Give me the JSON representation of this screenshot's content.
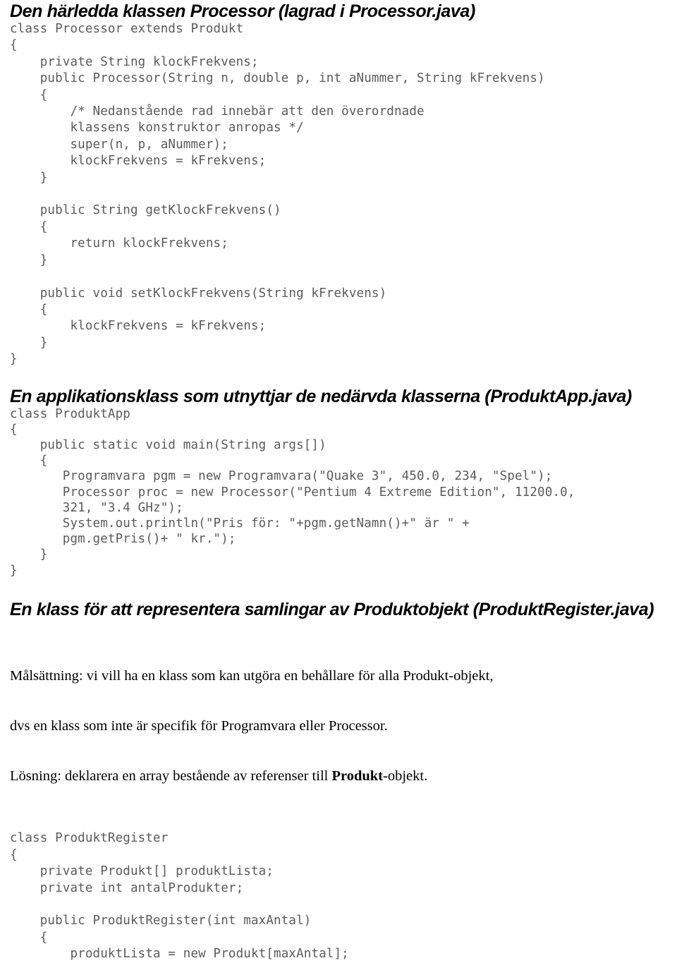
{
  "document": {
    "language": "sv",
    "sections": [
      {
        "id": "processor-class",
        "heading": "Den härledda klassen Processor (lagrad i Processor.java)",
        "code": [
          "class Processor extends Produkt",
          "{",
          "    private String klockFrekvens;",
          "    public Processor(String n, double p, int aNummer, String kFrekvens)",
          "    {",
          "        /* Nedanstående rad innebär att den överordnade",
          "        klassens konstruktor anropas */",
          "        super(n, p, aNummer);",
          "        klockFrekvens = kFrekvens;",
          "    }",
          "",
          "    public String getKlockFrekvens()",
          "    {",
          "        return klockFrekvens;",
          "    }",
          "",
          "    public void setKlockFrekvens(String kFrekvens)",
          "    {",
          "        klockFrekvens = kFrekvens;",
          "    }",
          "}"
        ]
      },
      {
        "id": "produktapp-class",
        "heading": "En applikationsklass som utnyttjar de nedärvda klasserna (ProduktApp.java)",
        "code": [
          "class ProduktApp",
          "{",
          "    public static void main(String args[])",
          "    {",
          "       Programvara pgm = new Programvara(\"Quake 3\", 450.0, 234, \"Spel\");",
          "       Processor proc = new Processor(\"Pentium 4 Extreme Edition\", 11200.0,",
          "       321, \"3.4 GHz\");",
          "       System.out.println(\"Pris för: \"+pgm.getNamn()+\" är \" +",
          "       pgm.getPris()+ \" kr.\");",
          "    }",
          "}"
        ]
      },
      {
        "id": "produktregister-class",
        "heading": "En klass för att representera samlingar av Produktobjekt (ProduktRegister.java)",
        "paragraph_lines": [
          {
            "runs": [
              {
                "text": "Målsättning: vi vill ha en klass som kan utgöra en behållare för alla Produkt-objekt,",
                "bold": false
              }
            ]
          },
          {
            "runs": [
              {
                "text": "dvs en klass som inte är specifik för Programvara eller Processor.",
                "bold": false
              }
            ]
          },
          {
            "runs": [
              {
                "text": "Lösning: deklarera en array bestående av referenser till ",
                "bold": false
              },
              {
                "text": "Produkt",
                "bold": true
              },
              {
                "text": "-objekt.",
                "bold": false
              }
            ]
          }
        ],
        "code": [
          "class ProduktRegister",
          "{",
          "    private Produkt[] produktLista;",
          "    private int antalProdukter;",
          "",
          "    public ProduktRegister(int maxAntal)",
          "    {",
          "        produktLista = new Produkt[maxAntal];"
        ]
      }
    ]
  },
  "colors": {
    "page_background": "#ffffff",
    "heading_text": "#000000",
    "code_text": "#5b5b5b",
    "body_text": "#000000"
  }
}
